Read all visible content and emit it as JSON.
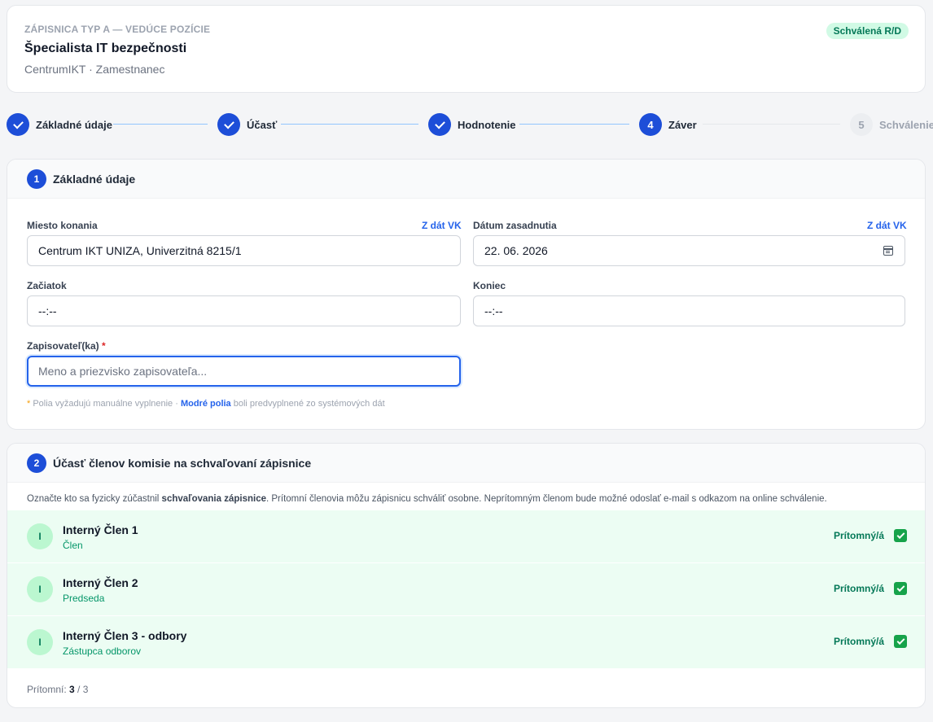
{
  "header": {
    "kicker": "ZÁPISNICA TYP A — VEDÚCE POZÍCIE",
    "title": "Špecialista IT bezpečnosti",
    "subtitle": "CentrumIKT · Zamestnanec",
    "status_badge": "Schválená R/D"
  },
  "stepper": [
    {
      "label": "Základné údaje",
      "number": "1",
      "state": "done"
    },
    {
      "label": "Účasť",
      "number": "2",
      "state": "done"
    },
    {
      "label": "Hodnotenie",
      "number": "3",
      "state": "done"
    },
    {
      "label": "Záver",
      "number": "4",
      "state": "current"
    },
    {
      "label": "Schválenie",
      "number": "5",
      "state": "pending"
    }
  ],
  "section1": {
    "number": "1",
    "title": "Základné údaje",
    "place_label": "Miesto konania",
    "place_link": "Z dát VK",
    "place_value": "Centrum IKT UNIZA, Univerzitná 8215/1",
    "date_label": "Dátum zasadnutia",
    "date_link": "Z dát VK",
    "date_value": "22. 06. 2026",
    "start_label": "Začiatok",
    "start_value": "--:--",
    "end_label": "Koniec",
    "end_value": "--:--",
    "writer_label": "Zapisovateľ(ka)",
    "writer_required": "*",
    "writer_placeholder": "Meno a priezvisko zapisovateľa...",
    "note_asterisk": "*",
    "note_part1": "Polia vyžadujú manuálne vyplnenie · ",
    "note_blue": "Modré polia",
    "note_part2": " boli predvyplnené zo systémových dát"
  },
  "section2": {
    "number": "2",
    "title": "Účasť členov komisie na schvaľovaní zápisnice",
    "intro_part1": "Označte kto sa fyzicky zúčastnil ",
    "intro_bold": "schvaľovania zápisnice",
    "intro_part2": ". Prítomní členovia môžu zápisnicu schváliť osobne. Neprítomným členom bude možné odoslať e-mail s odkazom na online schválenie.",
    "members": [
      {
        "initial": "I",
        "name": "Interný Člen 1",
        "role": "Člen",
        "presence_label": "Prítomný/á",
        "present": true
      },
      {
        "initial": "I",
        "name": "Interný Člen 2",
        "role": "Predseda",
        "presence_label": "Prítomný/á",
        "present": true
      },
      {
        "initial": "I",
        "name": "Interný Člen 3 - odbory",
        "role": "Zástupca odborov",
        "presence_label": "Prítomný/á",
        "present": true
      }
    ],
    "count_label": "Prítomní: ",
    "count_present": "3",
    "count_total": " / 3"
  }
}
